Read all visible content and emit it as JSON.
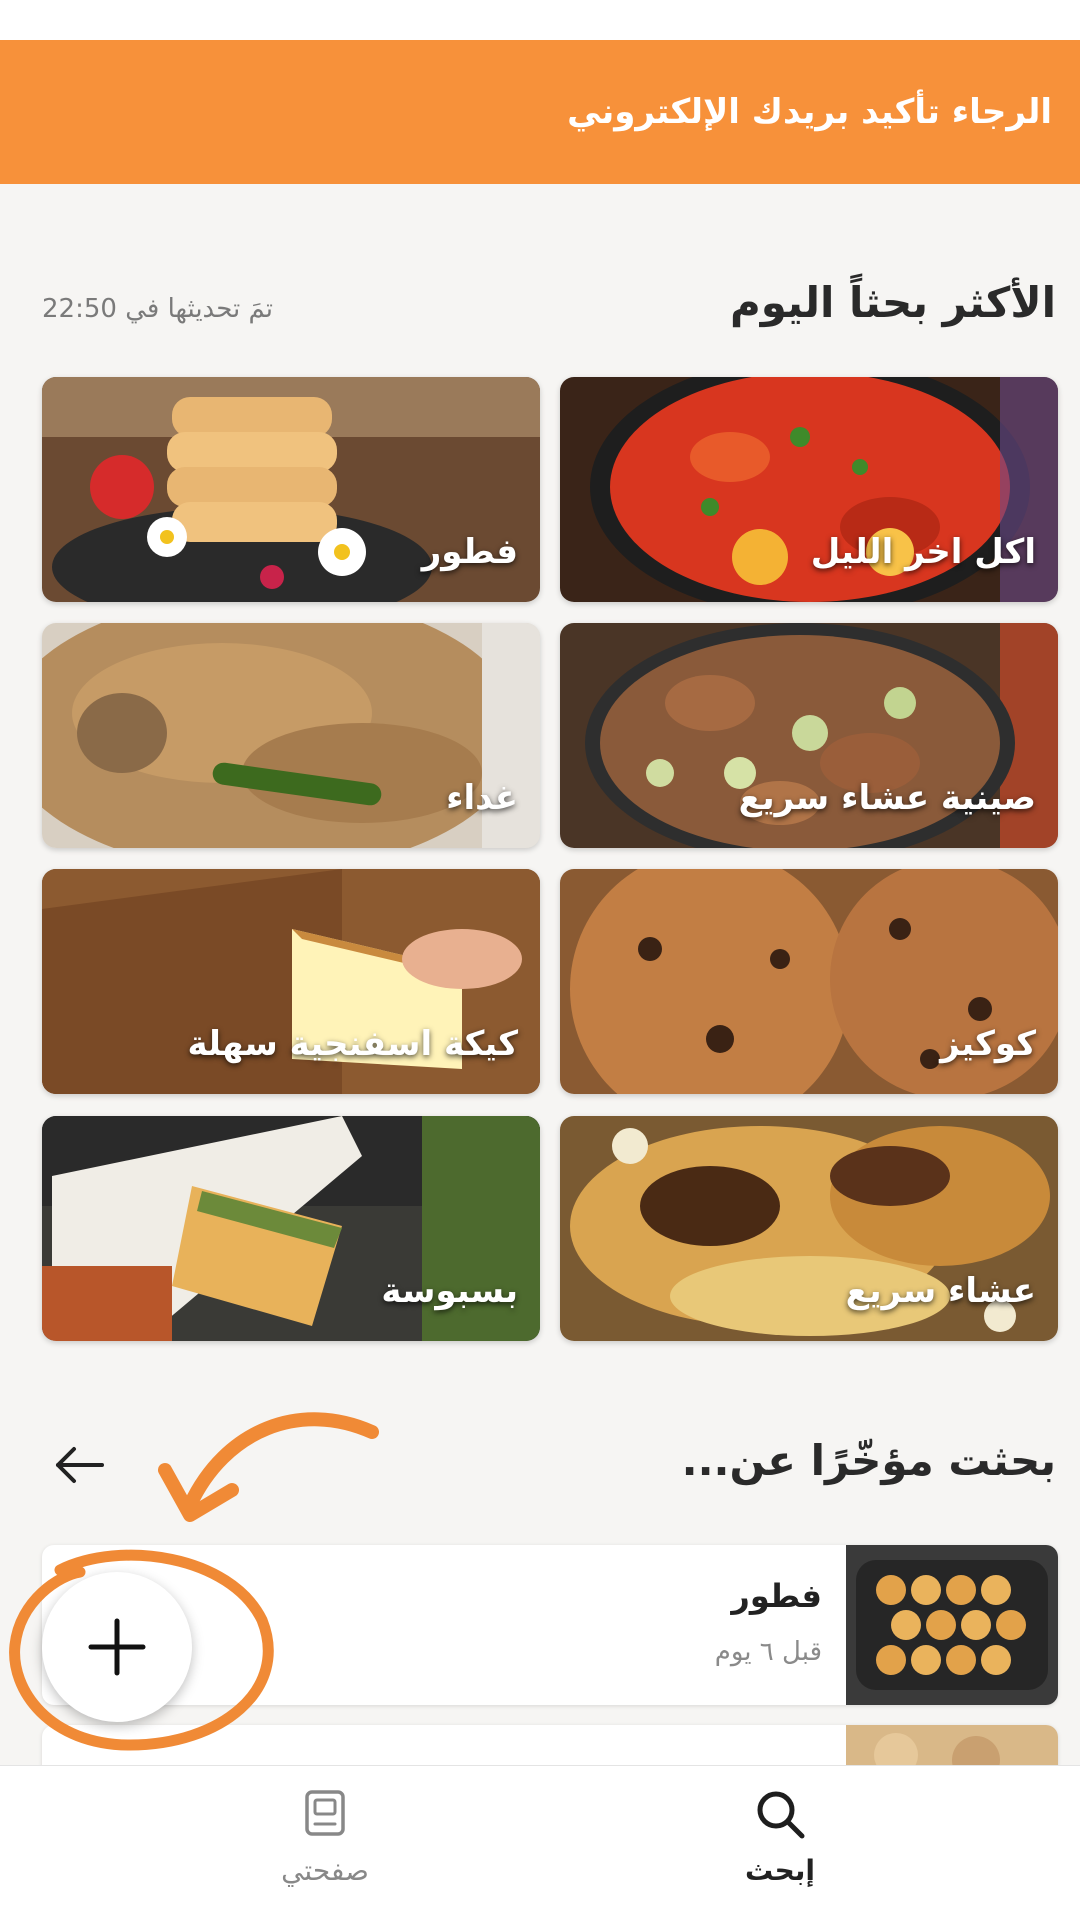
{
  "banner": {
    "text": "الرجاء تأكيد بريدك الإلكتروني"
  },
  "trending": {
    "title": "الأكثر بحثاً اليوم",
    "updated": "تمَ تحديثها في 22:50",
    "tiles": [
      {
        "label": "اكل اخر الليل"
      },
      {
        "label": "فطور"
      },
      {
        "label": "صينية عشاء سريع"
      },
      {
        "label": "غداء"
      },
      {
        "label": "كوكيز"
      },
      {
        "label": "كيكة اسفنجية سهلة"
      },
      {
        "label": "عشاء سريع"
      },
      {
        "label": "بسبوسة"
      }
    ]
  },
  "recent": {
    "title": "بحثت مؤخّرًا عن...",
    "items": [
      {
        "title": "فطور",
        "time": "قبل ٦ يوم"
      }
    ]
  },
  "fab": {
    "icon": "plus-icon"
  },
  "bottom_nav": {
    "search_label": "إبحث",
    "mine_label": "صفحتي"
  },
  "colors": {
    "accent": "#f7913a",
    "background": "#f6f5f3"
  }
}
